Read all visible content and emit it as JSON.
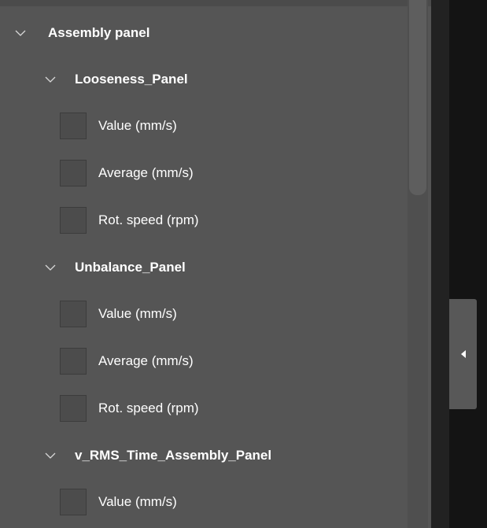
{
  "tree": {
    "root": {
      "label": "Assembly panel",
      "icon": "chevron-down-icon"
    },
    "groups": [
      {
        "label": "Looseness_Panel",
        "icon": "chevron-down-icon",
        "items": [
          {
            "label": "Value (mm/s)",
            "checked": false
          },
          {
            "label": "Average (mm/s)",
            "checked": false
          },
          {
            "label": "Rot. speed (rpm)",
            "checked": false
          }
        ]
      },
      {
        "label": "Unbalance_Panel",
        "icon": "chevron-down-icon",
        "items": [
          {
            "label": "Value (mm/s)",
            "checked": false
          },
          {
            "label": "Average (mm/s)",
            "checked": false
          },
          {
            "label": "Rot. speed (rpm)",
            "checked": false
          }
        ]
      },
      {
        "label": "v_RMS_Time_Assembly_Panel",
        "icon": "chevron-down-icon",
        "items": [
          {
            "label": "Value (mm/s)",
            "checked": false
          }
        ]
      }
    ]
  },
  "collapse_toggle": {
    "icon": "triangle-left-icon"
  },
  "colors": {
    "panel_background": "#555555",
    "checkbox_fill": "#4c4c4c",
    "text": "#ffffff",
    "dark_area": "#141414"
  }
}
